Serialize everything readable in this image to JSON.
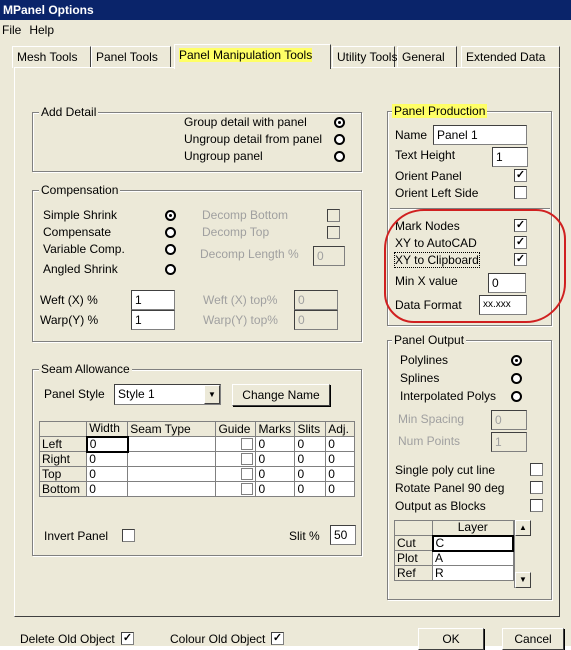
{
  "window": {
    "title": "MPanel Options"
  },
  "menu": {
    "file": "File",
    "help": "Help"
  },
  "tabs": [
    "Mesh Tools",
    "Panel Tools",
    "Panel Manipulation Tools",
    "Utility Tools",
    "General",
    "Extended Data"
  ],
  "active_tab": "Panel Manipulation Tools",
  "add_detail": {
    "legend": "Add Detail",
    "options": [
      {
        "label": "Group detail with panel",
        "selected": true
      },
      {
        "label": "Ungroup detail from panel",
        "selected": false
      },
      {
        "label": "Ungroup panel",
        "selected": false
      }
    ]
  },
  "compensation": {
    "legend": "Compensation",
    "options": [
      {
        "label": "Simple Shrink",
        "selected": true
      },
      {
        "label": "Compensate",
        "selected": false
      },
      {
        "label": "Variable Comp.",
        "selected": false
      },
      {
        "label": "Angled Shrink",
        "selected": false
      }
    ],
    "decomp_bottom": "Decomp Bottom",
    "decomp_top": "Decomp Top",
    "decomp_length_label": "Decomp Length %",
    "decomp_length_value": "0",
    "weft_label": "Weft (X)  %",
    "weft_value": "1",
    "warp_label": "Warp(Y)  %",
    "warp_value": "1",
    "weft_top_label": "Weft (X)  top%",
    "weft_top_value": "0",
    "warp_top_label": "Warp(Y)  top%",
    "warp_top_value": "0"
  },
  "seam": {
    "legend": "Seam Allowance",
    "panel_style_label": "Panel Style",
    "panel_style_value": "Style 1",
    "change_name": "Change Name",
    "columns": [
      "Width",
      "Seam Type",
      "Guide",
      "Marks",
      "Slits",
      "Adj."
    ],
    "rows": [
      {
        "name": "Left",
        "width": "0",
        "seam_type": "",
        "marks": "0",
        "slits": "0",
        "adj": "0"
      },
      {
        "name": "Right",
        "width": "0",
        "seam_type": "",
        "marks": "0",
        "slits": "0",
        "adj": "0"
      },
      {
        "name": "Top",
        "width": "0",
        "seam_type": "",
        "marks": "0",
        "slits": "0",
        "adj": "0"
      },
      {
        "name": "Bottom",
        "width": "0",
        "seam_type": "",
        "marks": "0",
        "slits": "0",
        "adj": "0"
      }
    ],
    "invert_panel": "Invert Panel",
    "slit_label": "Slit %",
    "slit_value": "50"
  },
  "production": {
    "legend": "Panel Production",
    "name_label": "Name",
    "name_value": "Panel 1",
    "text_height_label": "Text Height",
    "text_height_value": "1",
    "orient_panel": "Orient Panel",
    "orient_left": "Orient Left Side",
    "mark_nodes": "Mark Nodes",
    "xy_autocad": "XY to AutoCAD",
    "xy_clipboard": "XY to Clipboard",
    "min_x_label": "Min X value",
    "min_x_value": "0",
    "data_format_label": "Data Format",
    "data_format_value": "xx.xxx"
  },
  "output": {
    "legend": "Panel Output",
    "options": [
      {
        "label": "Polylines",
        "selected": true
      },
      {
        "label": "Splines",
        "selected": false
      },
      {
        "label": "Interpolated Polys",
        "selected": false
      }
    ],
    "min_spacing_label": "Min Spacing",
    "min_spacing_value": "0",
    "num_points_label": "Num Points",
    "num_points_value": "1",
    "single_poly": "Single poly cut line",
    "rotate_panel": "Rotate Panel 90 deg",
    "output_blocks": "Output as Blocks",
    "layer_header": "Layer",
    "layers": [
      {
        "name": "Cut",
        "value": "C"
      },
      {
        "name": "Plot",
        "value": "A"
      },
      {
        "name": "Ref",
        "value": "R"
      }
    ]
  },
  "footer": {
    "delete_old": "Delete Old Object",
    "colour_old": "Colour Old Object",
    "ok": "OK",
    "cancel": "Cancel"
  },
  "colors": {
    "title_bar": "#0a246a",
    "highlight": "#ffff66",
    "annotation": "#d02020"
  }
}
